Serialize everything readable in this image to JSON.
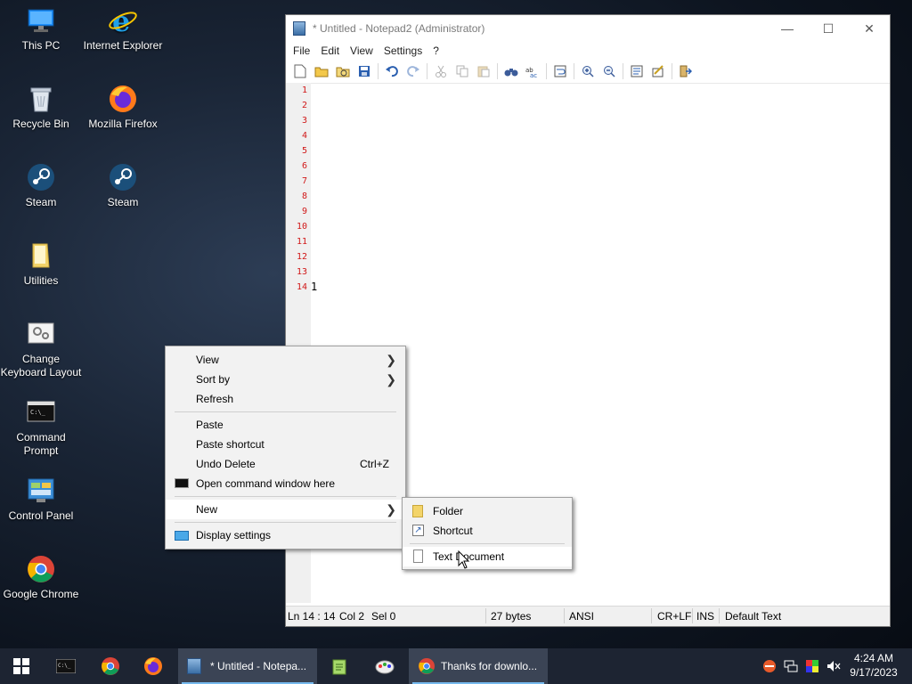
{
  "desktop": {
    "icons": [
      {
        "label": "This PC"
      },
      {
        "label": "Internet Explorer"
      },
      {
        "label": "Recycle Bin"
      },
      {
        "label": "Mozilla Firefox"
      },
      {
        "label": "Steam"
      },
      {
        "label": "Steam"
      },
      {
        "label": "Utilities"
      },
      {
        "label": "Change\nKeyboard Layout"
      },
      {
        "label": "Command\nPrompt"
      },
      {
        "label": "Control Panel"
      },
      {
        "label": "Google Chrome"
      }
    ]
  },
  "notepad": {
    "title": "* Untitled - Notepad2 (Administrator)",
    "minimize": "—",
    "maximize": "☐",
    "close": "✕",
    "menu": [
      "File",
      "Edit",
      "View",
      "Settings",
      "?"
    ],
    "line_numbers": [
      "1",
      "2",
      "3",
      "4",
      "5",
      "6",
      "7",
      "8",
      "9",
      "10",
      "11",
      "12",
      "13",
      "14"
    ],
    "content_line_14": "1",
    "status": {
      "position": "Ln 14 : 14",
      "col": "Col 2",
      "sel": "Sel 0",
      "size": "27 bytes",
      "encoding": "ANSI",
      "eol": "CR+LF",
      "mode": "INS",
      "scheme": "Default Text"
    }
  },
  "context_menu": {
    "view": "View",
    "sort_by": "Sort by",
    "refresh": "Refresh",
    "paste": "Paste",
    "paste_shortcut": "Paste shortcut",
    "undo_delete": "Undo Delete",
    "undo_shortcut": "Ctrl+Z",
    "open_cmd": "Open command window here",
    "new": "New",
    "display_settings": "Display settings"
  },
  "submenu_new": {
    "folder": "Folder",
    "shortcut": "Shortcut",
    "text_document": "Text Document"
  },
  "taskbar": {
    "tasks": [
      {
        "label": "* Untitled - Notepa..."
      },
      {
        "label": "Thanks for downlo..."
      }
    ],
    "time": "4:24 AM",
    "date": "9/17/2023"
  },
  "colors": {
    "accent": "#76b9ed",
    "line_number": "#d01818",
    "taskbar": "#1d2432"
  }
}
